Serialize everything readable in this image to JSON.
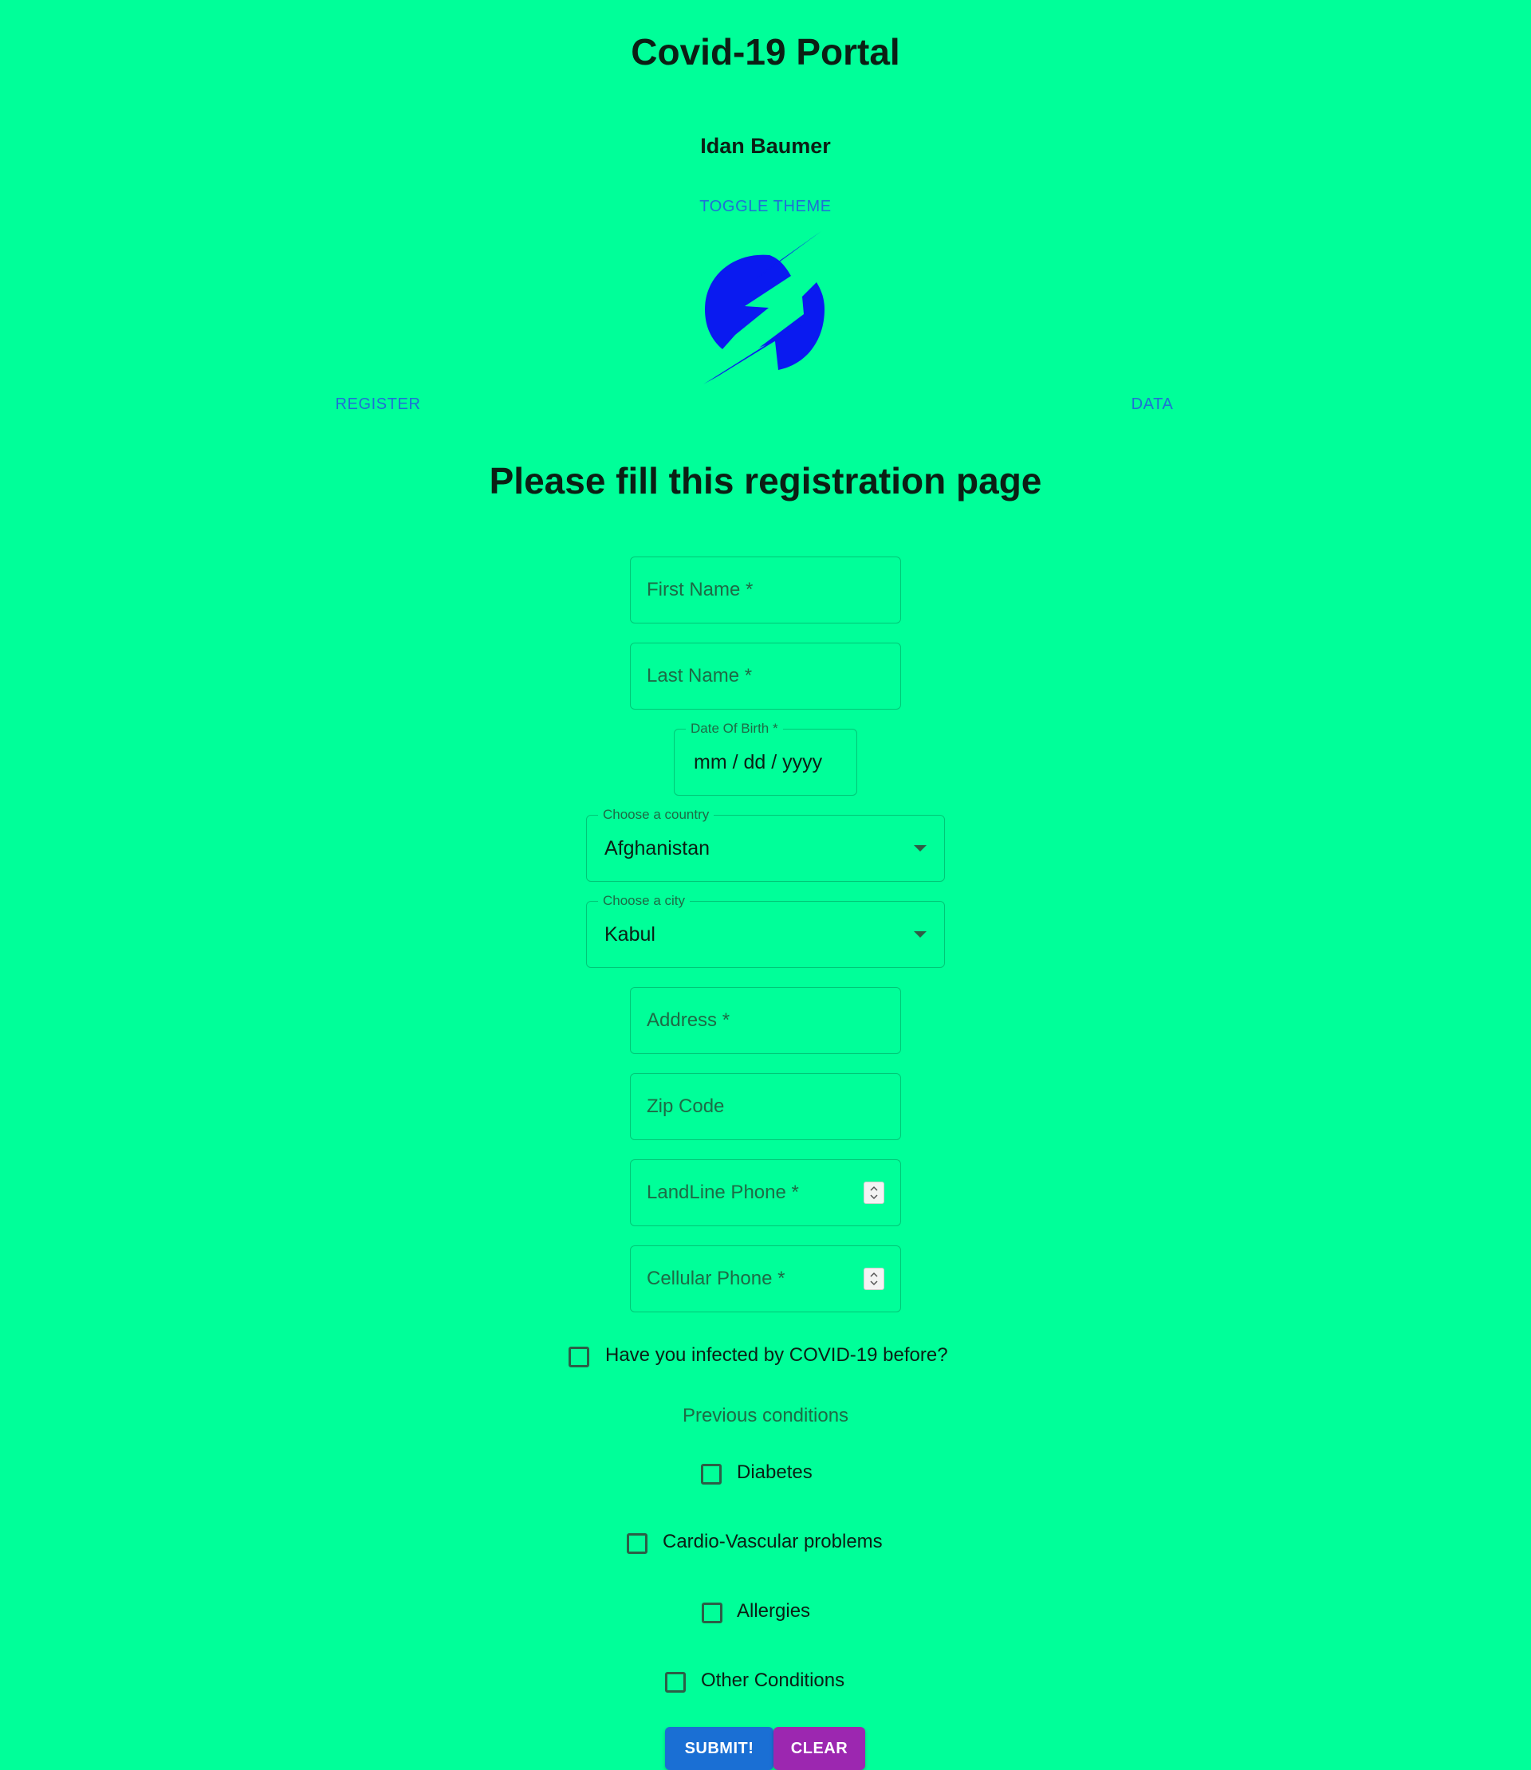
{
  "header": {
    "title": "Covid-19 Portal",
    "author": "Idan Baumer",
    "toggle_theme": "TOGGLE THEME",
    "logo_icon": "lightning-bolt-circle-logo"
  },
  "nav": {
    "register": "REGISTER",
    "data": "DATA"
  },
  "form": {
    "title": "Please fill this registration page",
    "first_name_placeholder": "First Name *",
    "last_name_placeholder": "Last Name *",
    "dob_label": "Date Of Birth *",
    "dob_value": "mm / dd / yyyy",
    "country_label": "Choose a country",
    "country_value": "Afghanistan",
    "city_label": "Choose a city",
    "city_value": "Kabul",
    "address_placeholder": "Address *",
    "zip_placeholder": "Zip Code",
    "landline_placeholder": "LandLine Phone *",
    "cellular_placeholder": "Cellular Phone *",
    "infected_label": "Have you infected by COVID-19 before?",
    "conditions_title": "Previous conditions",
    "conditions": [
      {
        "label": "Diabetes",
        "checked": false
      },
      {
        "label": "Cardio-Vascular problems",
        "checked": false
      },
      {
        "label": "Allergies",
        "checked": false
      },
      {
        "label": "Other Conditions",
        "checked": false
      }
    ],
    "submit_label": "SUBMIT!",
    "clear_label": "CLEAR"
  },
  "colors": {
    "background": "#00FF99",
    "link": "#1f6fd6",
    "logo": "#0a1af0",
    "submit": "#1a6fd4",
    "clear": "#9c27b0"
  }
}
